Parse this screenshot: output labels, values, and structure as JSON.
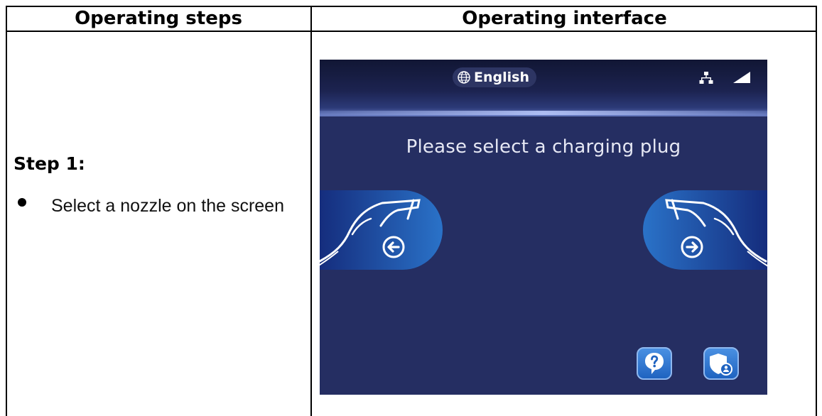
{
  "table": {
    "header_steps": "Operating steps",
    "header_interface": "Operating interface",
    "step_title": "Step 1:",
    "bullet_text": "Select a nozzle on the screen"
  },
  "screen": {
    "language": "English",
    "prompt": "Please select a charging plug",
    "icons": [
      "globe-icon",
      "network-icon",
      "signal-icon",
      "arrow-left-icon",
      "arrow-right-icon",
      "help-icon",
      "admin-shield-icon"
    ],
    "colors": {
      "background": "#252e62",
      "accent": "#1f63c0"
    }
  }
}
